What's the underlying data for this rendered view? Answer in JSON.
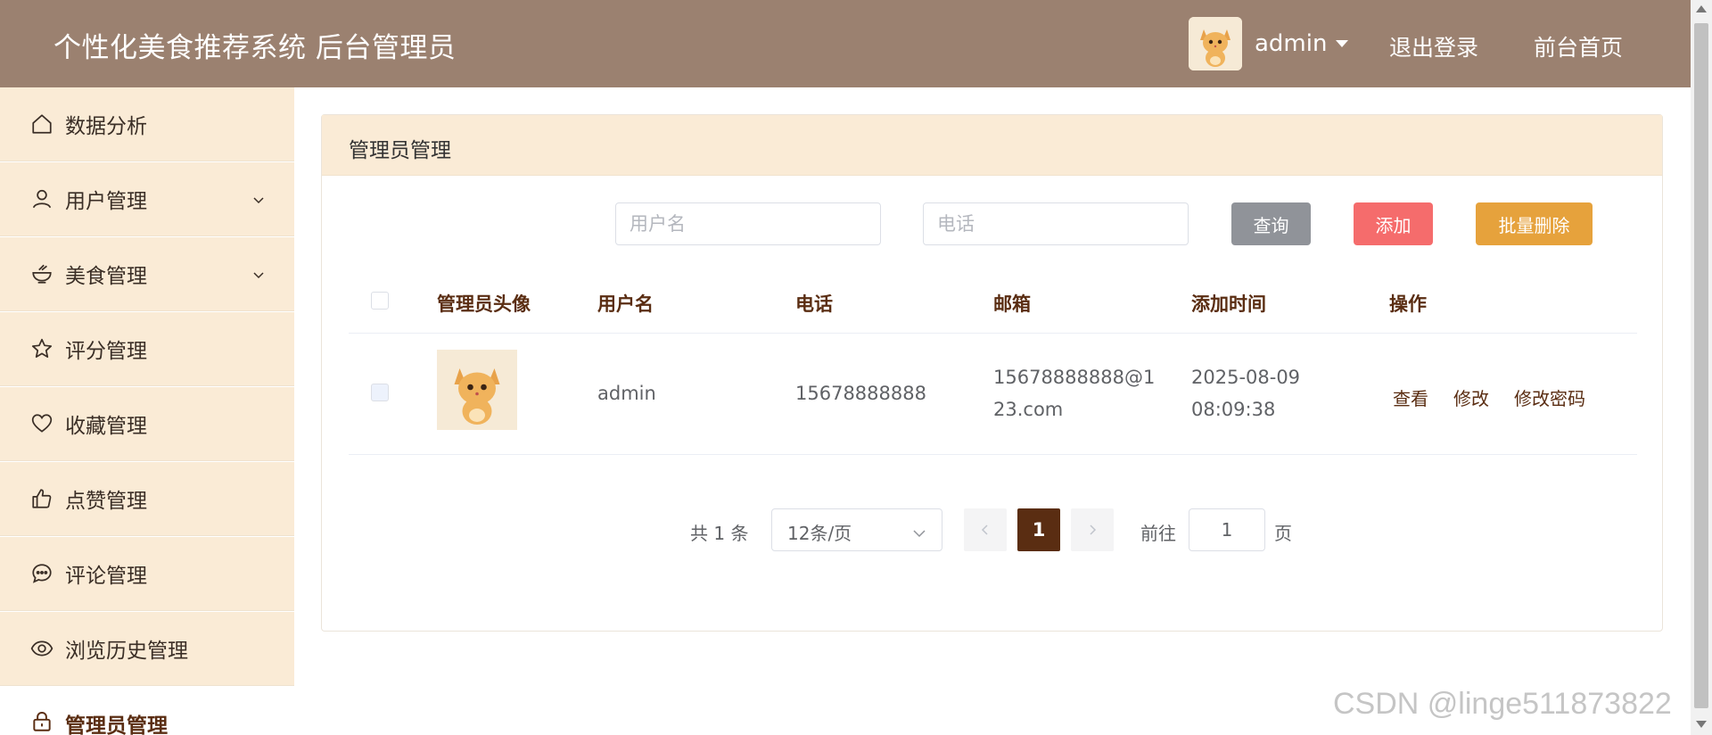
{
  "header": {
    "title": "个性化美食推荐系统 后台管理员",
    "username": "admin",
    "logout_label": "退出登录",
    "home_label": "前台首页"
  },
  "sidebar": {
    "items": [
      {
        "label": "数据分析",
        "icon": "home-icon"
      },
      {
        "label": "用户管理",
        "icon": "user-icon"
      },
      {
        "label": "美食管理",
        "icon": "bowl-icon"
      },
      {
        "label": "评分管理",
        "icon": "star-icon"
      },
      {
        "label": "收藏管理",
        "icon": "heart-icon"
      },
      {
        "label": "点赞管理",
        "icon": "thumb-up-icon"
      },
      {
        "label": "评论管理",
        "icon": "comment-icon"
      },
      {
        "label": "浏览历史管理",
        "icon": "eye-icon"
      },
      {
        "label": "管理员管理",
        "icon": "lock-icon"
      }
    ]
  },
  "main": {
    "card_title": "管理员管理",
    "search": {
      "username_placeholder": "用户名",
      "phone_placeholder": "电话",
      "query_label": "查询",
      "add_label": "添加",
      "batch_delete_label": "批量删除"
    },
    "table": {
      "headers": [
        "管理员头像",
        "用户名",
        "电话",
        "邮箱",
        "添加时间",
        "操作"
      ],
      "rows": [
        {
          "username": "admin",
          "phone": "15678888888",
          "email_line1": "15678888888@1",
          "email_line2": "23.com",
          "date": "2025-08-09",
          "time": "08:09:38",
          "actions": [
            "查看",
            "修改",
            "修改密码"
          ]
        }
      ]
    },
    "pagination": {
      "total_text": "共 1 条",
      "page_size": "12条/页",
      "current_page": "1",
      "goto_label": "前往",
      "goto_value": "1",
      "page_suffix": "页"
    }
  },
  "watermark": "CSDN @linge511873822",
  "colors": {
    "header_bg": "#9b8170",
    "sidebar_bg": "#faebd6",
    "accent": "#5a2d12",
    "query_btn": "#909399",
    "add_btn": "#f56c6c",
    "batch_btn": "#e6a23c"
  }
}
